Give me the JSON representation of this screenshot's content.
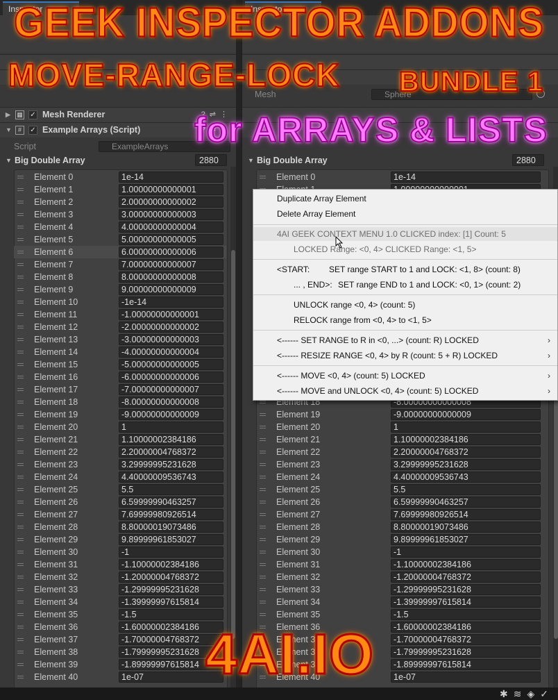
{
  "overlay": {
    "title_line1": "GEEK INSPECTOR ADDONS",
    "title_line2": "MOVE-RANGE-LOCK",
    "title_bundle": "BUNDLE 1",
    "title_lists": "for ARRAYS & LISTS",
    "logo": "4AI.IO"
  },
  "left": {
    "tab_label": "Inspector",
    "components": {
      "mesh_renderer": "Mesh Renderer",
      "example_arrays": "Example Arrays (Script)"
    },
    "script_label": "Script",
    "script_value": "ExampleArrays",
    "array_title": "Big Double Array",
    "array_count": "2880"
  },
  "right": {
    "mesh_field_label": "Mesh",
    "mesh_field_value": "Sphere",
    "array_title": "Big Double Array",
    "array_count": "2880"
  },
  "elements": [
    {
      "label": "Element 0",
      "value": "1e-14"
    },
    {
      "label": "Element 1",
      "value": "1.00000000000001"
    },
    {
      "label": "Element 2",
      "value": "2.00000000000002"
    },
    {
      "label": "Element 3",
      "value": "3.00000000000003"
    },
    {
      "label": "Element 4",
      "value": "4.00000000000004"
    },
    {
      "label": "Element 5",
      "value": "5.00000000000005"
    },
    {
      "label": "Element 6",
      "value": "6.00000000000006"
    },
    {
      "label": "Element 7",
      "value": "7.00000000000007"
    },
    {
      "label": "Element 8",
      "value": "8.00000000000008"
    },
    {
      "label": "Element 9",
      "value": "9.00000000000009"
    },
    {
      "label": "Element 10",
      "value": "-1e-14"
    },
    {
      "label": "Element 11",
      "value": "-1.00000000000001"
    },
    {
      "label": "Element 12",
      "value": "-2.00000000000002"
    },
    {
      "label": "Element 13",
      "value": "-3.00000000000003"
    },
    {
      "label": "Element 14",
      "value": "-4.00000000000004"
    },
    {
      "label": "Element 15",
      "value": "-5.00000000000005"
    },
    {
      "label": "Element 16",
      "value": "-6.00000000000006"
    },
    {
      "label": "Element 17",
      "value": "-7.00000000000007"
    },
    {
      "label": "Element 18",
      "value": "-8.00000000000008"
    },
    {
      "label": "Element 19",
      "value": "-9.00000000000009"
    },
    {
      "label": "Element 20",
      "value": "1"
    },
    {
      "label": "Element 21",
      "value": "1.10000002384186"
    },
    {
      "label": "Element 22",
      "value": "2.20000004768372"
    },
    {
      "label": "Element 23",
      "value": "3.29999995231628"
    },
    {
      "label": "Element 24",
      "value": "4.40000009536743"
    },
    {
      "label": "Element 25",
      "value": "5.5"
    },
    {
      "label": "Element 26",
      "value": "6.59999990463257"
    },
    {
      "label": "Element 27",
      "value": "7.69999980926514"
    },
    {
      "label": "Element 28",
      "value": "8.80000019073486"
    },
    {
      "label": "Element 29",
      "value": "9.89999961853027"
    },
    {
      "label": "Element 30",
      "value": "-1"
    },
    {
      "label": "Element 31",
      "value": "-1.10000002384186"
    },
    {
      "label": "Element 32",
      "value": "-1.20000004768372"
    },
    {
      "label": "Element 33",
      "value": "-1.29999995231628"
    },
    {
      "label": "Element 34",
      "value": "-1.39999997615814"
    },
    {
      "label": "Element 35",
      "value": "-1.5"
    },
    {
      "label": "Element 36",
      "value": "-1.60000002384186"
    },
    {
      "label": "Element 37",
      "value": "-1.70000004768372"
    },
    {
      "label": "Element 38",
      "value": "-1.79999995231628"
    },
    {
      "label": "Element 39",
      "value": "-1.89999997615814"
    },
    {
      "label": "Element 40",
      "value": "1e-07"
    }
  ],
  "context_menu": {
    "duplicate": "Duplicate Array Element",
    "delete": "Delete Array Element",
    "info1": "4AI GEEK CONTEXT MENU  1.0    CLICKED index:  [1]  Count:  5",
    "info2": "LOCKED Range:  <0,  4>   CLICKED Range: <1, 5>",
    "start_key": "<START:",
    "start_text": "SET range START to  1  and LOCK:  <1, 8>  (count: 8)",
    "end_key": "... , END>:",
    "end_text": "SET range END to  1  and LOCK:  <0, 1>  (count: 2)",
    "unlock": "UNLOCK range  <0, 4>  (count: 5)",
    "relock": "RELOCK range from  <0, 4>  to  <1, 5>",
    "set_range": "<------ SET RANGE to R in  <0, ...>  (count: R)  LOCKED",
    "resize_range": "<------ RESIZE RANGE  <0, 4> by R  (count: 5 + R)  LOCKED",
    "move": "<------ MOVE  <0, 4>  (count: 5)  LOCKED",
    "move_unlock": "<------ MOVE and UNLOCK  <0, 4>  (count: 5)  LOCKED",
    "submenu_arrow": "›"
  },
  "icons": [
    "lines-grip-icon",
    "checkbox-icon",
    "help-icon",
    "preset-icon",
    "more-icon",
    "bug-icon",
    "layers-icon",
    "sphere-icon",
    "collab-icon",
    "cursor-icon"
  ],
  "colors": {
    "panel": "#383838",
    "field": "#2a2a2a",
    "menu": "#f0f0f0",
    "title_orange": "#ff8a10",
    "title_pink": "#ff7cff"
  }
}
